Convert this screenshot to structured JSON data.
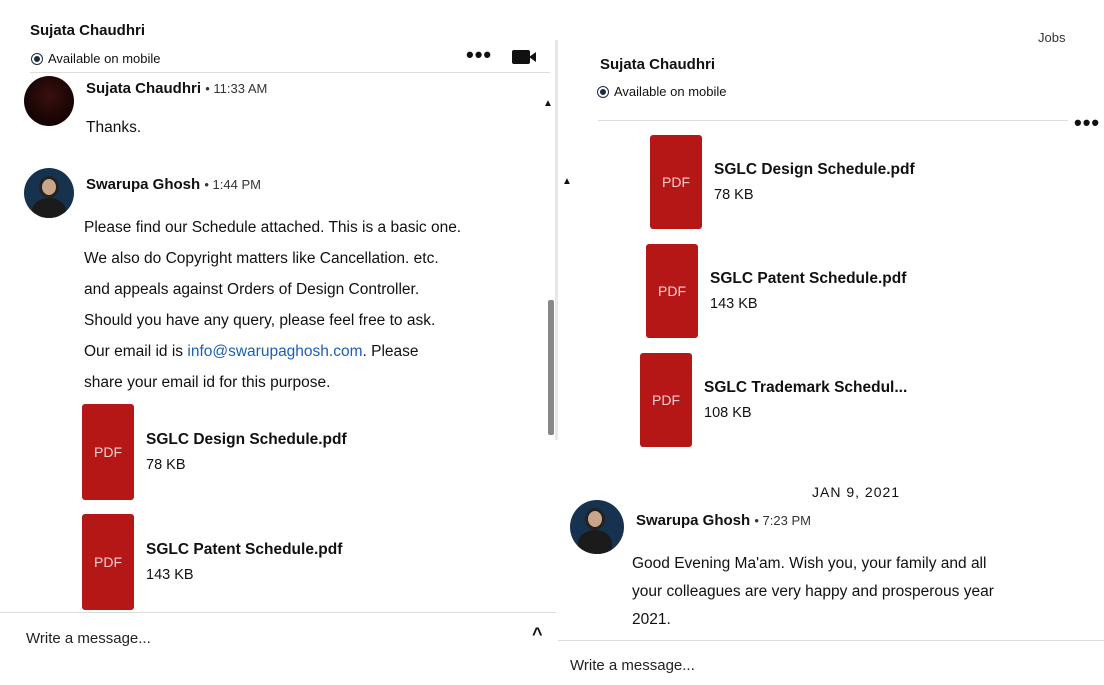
{
  "left": {
    "header": {
      "name": "Sujata Chaudhri",
      "status": "Available on mobile"
    },
    "messages": [
      {
        "sender": "Sujata Chaudhri",
        "time": "11:33 AM",
        "lines": [
          "Thanks."
        ]
      },
      {
        "sender": "Swarupa Ghosh",
        "time": "1:44 PM",
        "lines": [
          "Please find our Schedule attached. This is a basic one.",
          "We also do Copyright matters like Cancellation. etc.",
          "and appeals against Orders of Design Controller.",
          "Should you have any query, please feel free to ask."
        ],
        "email_prefix": "Our email id is ",
        "email": "info@swarupaghosh.com",
        "email_suffix": ". Please",
        "last_line": "share your email id for this purpose."
      }
    ],
    "attachments": [
      {
        "icon": "PDF",
        "name": "SGLC Design Schedule.pdf",
        "size": "78 KB"
      },
      {
        "icon": "PDF",
        "name": "SGLC Patent Schedule.pdf",
        "size": "143 KB"
      }
    ],
    "compose_placeholder": "Write a message..."
  },
  "right": {
    "top_link": "Jobs",
    "header": {
      "name": "Sujata Chaudhri",
      "status": "Available on mobile"
    },
    "attachments": [
      {
        "icon": "PDF",
        "name": "SGLC Design Schedule.pdf",
        "size": "78 KB"
      },
      {
        "icon": "PDF",
        "name": "SGLC Patent Schedule.pdf",
        "size": "143 KB"
      },
      {
        "icon": "PDF",
        "name": "SGLC Trademark Schedul...",
        "size": "108 KB"
      }
    ],
    "date_separator": "JAN 9, 2021",
    "message": {
      "sender": "Swarupa Ghosh",
      "time": "7:23 PM",
      "lines": [
        "Good Evening Ma'am. Wish you, your family and all",
        "your colleagues are very happy and prosperous year",
        "2021."
      ]
    },
    "compose_placeholder": "Write a message..."
  },
  "colors": {
    "pdf_red": "#b51717",
    "link_blue": "#1a5fb4"
  }
}
